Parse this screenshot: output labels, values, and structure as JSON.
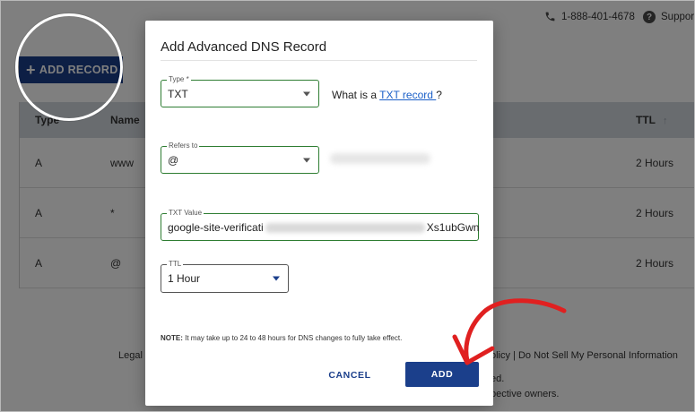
{
  "header": {
    "phone": "1-888-401-4678",
    "support": "Support"
  },
  "page": {
    "add_record_label": "ADD RECORD",
    "table": {
      "headers": {
        "type": "Type",
        "name": "Name",
        "ttl": "TTL"
      },
      "rows": [
        {
          "type": "A",
          "name": "www",
          "ttl": "2 Hours"
        },
        {
          "type": "A",
          "name": "*",
          "ttl": "2 Hours"
        },
        {
          "type": "A",
          "name": "@",
          "ttl": "2 Hours"
        }
      ]
    },
    "footer": {
      "legal": "Legal",
      "right_links": "olicy  |  Do Not Sell My Personal Information",
      "line2": "ed.",
      "line3": "pective owners."
    }
  },
  "modal": {
    "title": "Add Advanced DNS Record",
    "type_field": {
      "label": "Type *",
      "value": "TXT"
    },
    "whatis": {
      "prefix": "What is a ",
      "link": "TXT record ",
      "suffix": "?"
    },
    "refers_field": {
      "label": "Refers to",
      "value": "@"
    },
    "txt_field": {
      "label": "TXT Value",
      "value_start": "google-site-verificati",
      "value_end": "Xs1ubGwn"
    },
    "ttl_field": {
      "label": "TTL",
      "value": "1 Hour"
    },
    "note": {
      "bold": "NOTE:",
      "text": " It may take up to 24 to 48 hours for DNS changes to fully take effect."
    },
    "cancel_label": "CANCEL",
    "add_label": "ADD"
  },
  "colors": {
    "brand_blue": "#1b3f8b",
    "field_green": "#2e7d32",
    "annotation_red": "#e02020",
    "link_blue": "#1a5fc8"
  }
}
